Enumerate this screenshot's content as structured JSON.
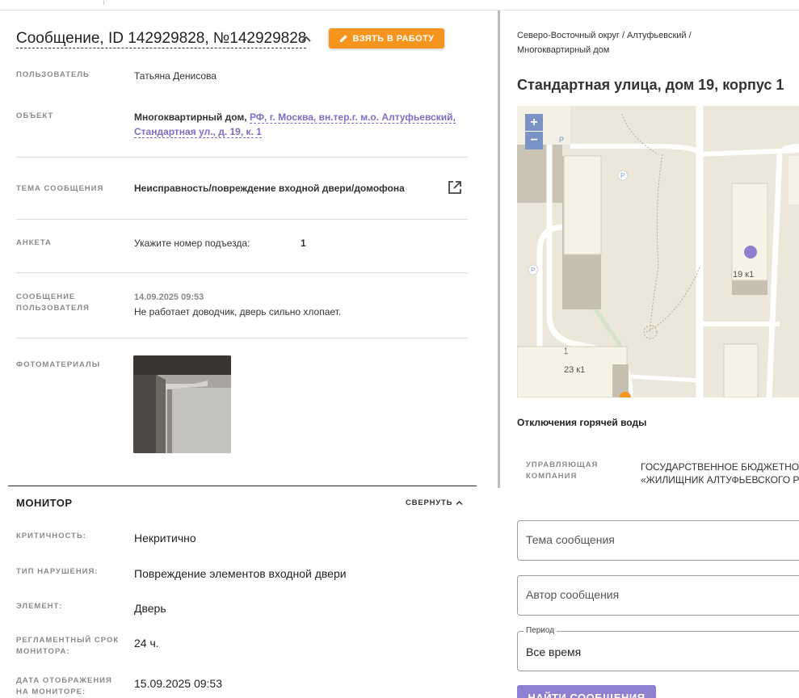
{
  "message": {
    "title": "Сообщение, ID 142929828, №142929828",
    "take_button": "ВЗЯТЬ В РАБОТУ",
    "rows": {
      "user_label": "ПОЛЬЗОВАТЕЛЬ",
      "user_value": "Татьяна Денисова",
      "object_label": "ОБЪЕКТ",
      "object_type": "Многоквартирный дом,",
      "object_address_1": "РФ, г. Москва, вн.тер.г. м.о. Алтуфьевский,",
      "object_address_2": "Стандартная ул., д. 19, к. 1",
      "topic_label": "ТЕМА СООБЩЕНИЯ",
      "topic_value": "Неисправность/повреждение входной двери/домофона",
      "survey_label": "АНКЕТА",
      "survey_question": "Укажите номер подъезда:",
      "survey_answer": "1",
      "user_message_label_1": "СООБЩЕНИЕ",
      "user_message_label_2": "ПОЛЬЗОВАТЕЛЯ",
      "user_message_date": "14.09.2025 09:53",
      "user_message_text": "Не работает доводчик, дверь сильно хлопает.",
      "photos_label": "ФОТОМАТЕРИАЛЫ"
    }
  },
  "monitor": {
    "title": "МОНИТОР",
    "collapse_label": "СВЕРНУТЬ",
    "criticality_label": "КРИТИЧНОСТЬ:",
    "criticality_value": "Некритично",
    "violation_label": "ТИП НАРУШЕНИЯ:",
    "violation_value": "Повреждение элементов входной двери",
    "element_label": "ЭЛЕМЕНТ:",
    "element_value": "Дверь",
    "deadline_label_1": "РЕГЛАМЕНТНЫЙ СРОК",
    "deadline_label_2": "МОНИТОРА:",
    "deadline_value": "24 ч.",
    "display_date_label_1": "ДАТА ОТОБРАЖЕНИЯ",
    "display_date_label_2": "НА МОНИТОРЕ:",
    "display_date_value": "15.09.2025 09:53"
  },
  "right": {
    "breadcrumb_1": "Северо-Восточный округ / Алтуфьевский /",
    "breadcrumb_2": "Многоквартирный дом",
    "address_title": "Стандартная улица, дом 19, корпус 1",
    "map": {
      "zoom_in": "+",
      "zoom_out": "−",
      "label_house": "19 к1",
      "label_house2": "23 к1",
      "parking": "P",
      "marker_color": "#8f7fd1"
    },
    "hot_water": "Отключения горячей воды",
    "uk_label_1": "УПРАВЛЯЮЩАЯ",
    "uk_label_2": "КОМПАНИЯ",
    "uk_value_1": "ГОСУДАРСТВЕННОЕ БЮДЖЕТНОЕ",
    "uk_value_2": "«ЖИЛИЩНИК АЛТУФЬЕВСКОГО Р",
    "topic_placeholder": "Тема сообщения",
    "author_placeholder": "Автор сообщения",
    "period_legend": "Период",
    "period_value": "Все время",
    "find_button": "НАЙТИ СООБЩЕНИЯ"
  },
  "colors": {
    "accent_orange": "#f7941d",
    "accent_purple": "#8f7fd1",
    "link": "#7b6fc4"
  }
}
